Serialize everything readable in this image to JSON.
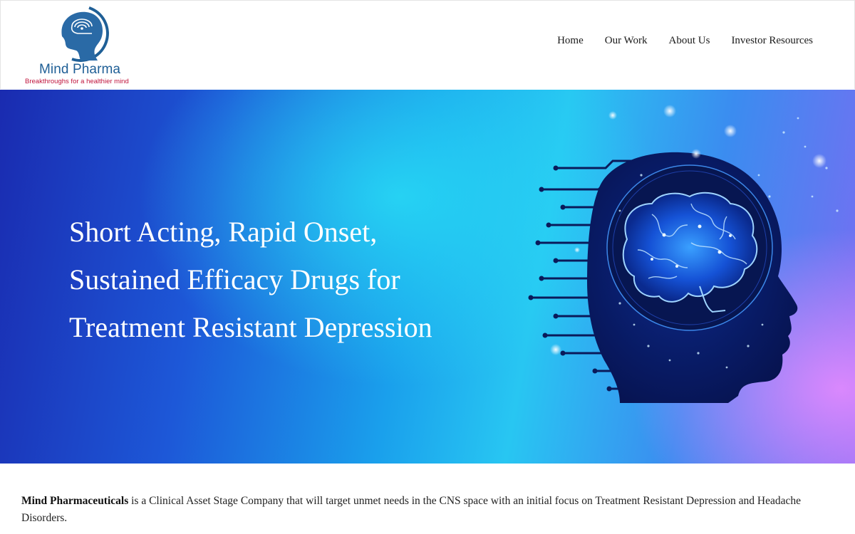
{
  "brand": {
    "name": "Mind Pharma",
    "tagline": "Breakthroughs for a healthier mind",
    "logo_icon": "head-with-spiral-icon"
  },
  "nav": {
    "items": [
      {
        "label": "Home"
      },
      {
        "label": "Our Work"
      },
      {
        "label": "About Us"
      },
      {
        "label": "Investor Resources"
      }
    ]
  },
  "hero": {
    "heading_lines": [
      "Short Acting, Rapid Onset,",
      "Sustained Efficacy Drugs for",
      "Treatment Resistant Depression"
    ],
    "image_icon": "digital-head-brain-icon"
  },
  "intro": {
    "company": "Mind Pharmaceuticals",
    "text": " is a Clinical Asset Stage Company that will target unmet needs in the CNS space with an initial focus on Treatment Resistant Depression and Headache Disorders."
  },
  "colors": {
    "brand_blue": "#1f5f96",
    "tagline_red": "#c0143c",
    "hero_deep_blue": "#1a2bb0",
    "hero_cyan": "#28c6f2"
  }
}
